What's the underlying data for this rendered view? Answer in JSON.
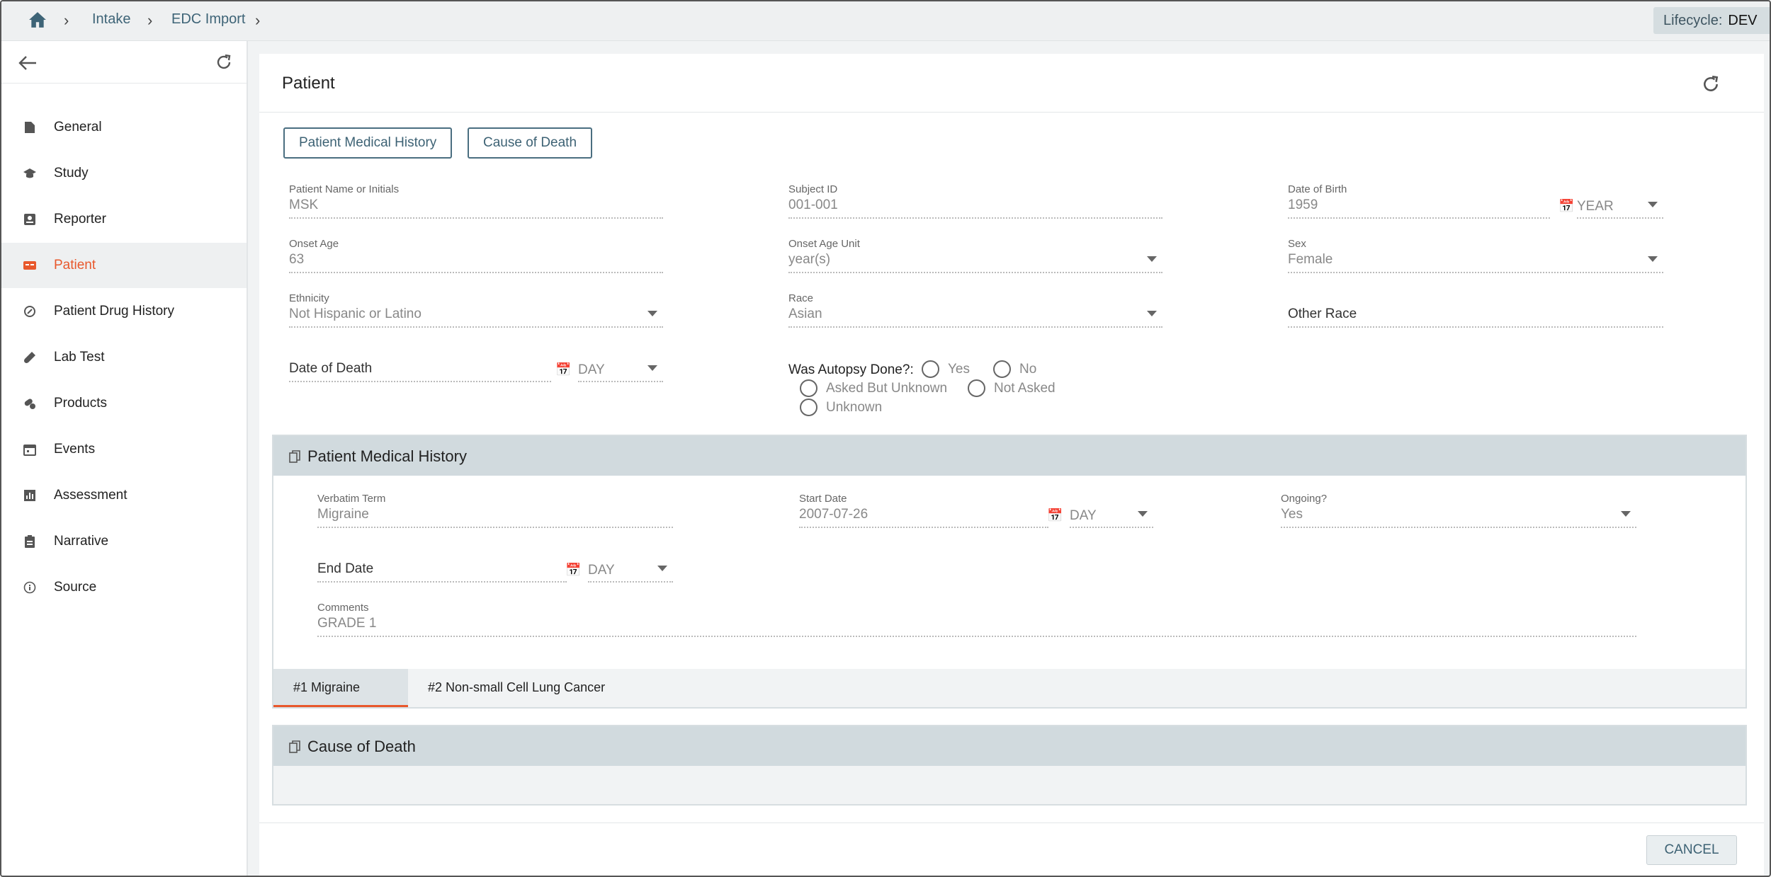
{
  "breadcrumb": {
    "items": [
      "Intake",
      "EDC Import"
    ]
  },
  "lifecycle": {
    "label": "Lifecycle:",
    "value": "DEV"
  },
  "sidebar": {
    "items": [
      {
        "label": "General",
        "icon": "file-icon"
      },
      {
        "label": "Study",
        "icon": "graduation-cap-icon"
      },
      {
        "label": "Reporter",
        "icon": "contact-card-icon"
      },
      {
        "label": "Patient",
        "icon": "patient-card-icon",
        "active": true
      },
      {
        "label": "Patient Drug History",
        "icon": "history-icon"
      },
      {
        "label": "Lab Test",
        "icon": "test-tube-icon"
      },
      {
        "label": "Products",
        "icon": "pills-icon"
      },
      {
        "label": "Events",
        "icon": "calendar-icon"
      },
      {
        "label": "Assessment",
        "icon": "bar-chart-icon"
      },
      {
        "label": "Narrative",
        "icon": "clipboard-icon"
      },
      {
        "label": "Source",
        "icon": "info-icon"
      }
    ]
  },
  "page": {
    "title": "Patient"
  },
  "jump_buttons": {
    "medical_history": "Patient Medical History",
    "cause_of_death": "Cause of Death"
  },
  "patient": {
    "name_label": "Patient Name or Initials",
    "name_value": "MSK",
    "subject_label": "Subject ID",
    "subject_value": "001-001",
    "dob_label": "Date of Birth",
    "dob_value": "1959",
    "dob_unit": "YEAR",
    "onset_age_label": "Onset Age",
    "onset_age_value": "63",
    "onset_unit_label": "Onset Age Unit",
    "onset_unit_value": "year(s)",
    "sex_label": "Sex",
    "sex_value": "Female",
    "ethnicity_label": "Ethnicity",
    "ethnicity_value": "Not Hispanic or Latino",
    "race_label": "Race",
    "race_value": "Asian",
    "other_race_placeholder": "Other Race",
    "dod_placeholder": "Date of Death",
    "dod_unit": "DAY",
    "autopsy_label": "Was Autopsy Done?:",
    "autopsy_options": [
      "Yes",
      "No",
      "Asked But Unknown",
      "Not Asked",
      "Unknown"
    ]
  },
  "medical_history": {
    "title": "Patient Medical History",
    "verbatim_label": "Verbatim Term",
    "verbatim_value": "Migraine",
    "start_label": "Start Date",
    "start_value": "2007-07-26",
    "start_unit": "DAY",
    "ongoing_label": "Ongoing?",
    "ongoing_value": "Yes",
    "end_placeholder": "End Date",
    "end_unit": "DAY",
    "comments_label": "Comments",
    "comments_value": "GRADE 1",
    "tabs": [
      "#1 Migraine",
      "#2 Non-small Cell Lung Cancer"
    ]
  },
  "cause_of_death": {
    "title": "Cause of Death"
  },
  "footer": {
    "cancel": "CANCEL"
  },
  "colors": {
    "accent": "#e8582c",
    "link": "#3e6477",
    "section_header": "#d1dade"
  }
}
